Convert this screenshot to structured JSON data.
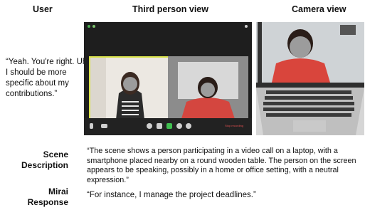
{
  "headers": {
    "user": "User",
    "third_person": "Third person view",
    "camera": "Camera view"
  },
  "user_quote": "“Yeah. You're right. Uh, I should be more specific about my contributions.”",
  "zoom_call": {
    "record_label": "Stop recording",
    "background": "#1e1e1e",
    "highlight_color": "#d9e24a",
    "toolbar_icons": [
      "microphone-icon",
      "video-camera-icon",
      "participants-icon",
      "chat-icon",
      "share-screen-icon",
      "record-icon",
      "reactions-icon"
    ]
  },
  "scene": {
    "label": "Scene Description",
    "text": "“The scene shows a person participating in a video call on a laptop, with a smartphone placed nearby on a round wooden table. The person on the screen appears to be speaking, possibly in a home or office setting, with a neutral expression.”"
  },
  "mirai": {
    "label": "Mirai Response",
    "text": "“For instance, I manage the project deadlines.”"
  }
}
